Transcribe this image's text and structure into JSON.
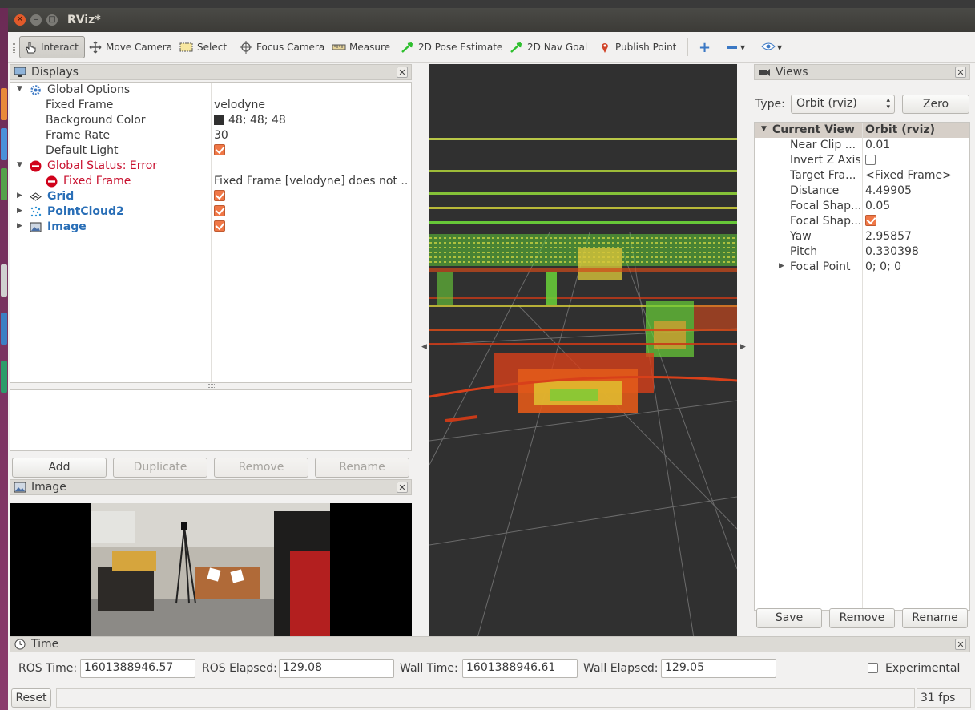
{
  "window": {
    "title": "RViz*"
  },
  "toolbar": {
    "tools": [
      "Interact",
      "Move Camera",
      "Select",
      "Focus Camera",
      "Measure",
      "2D Pose Estimate",
      "2D Nav Goal",
      "Publish Point"
    ]
  },
  "displays": {
    "title": "Displays",
    "rows": {
      "global_options": "Global Options",
      "fixed_frame_label": "Fixed Frame",
      "fixed_frame_value": "velodyne",
      "bg_color_label": "Background Color",
      "bg_color_value": "48; 48; 48",
      "frame_rate_label": "Frame Rate",
      "frame_rate_value": "30",
      "default_light_label": "Default Light",
      "global_status": "Global Status: Error",
      "status_fixed_frame": "Fixed Frame",
      "status_fixed_frame_value": "Fixed Frame [velodyne] does not ...",
      "grid": "Grid",
      "pointcloud2": "PointCloud2",
      "image": "Image"
    },
    "buttons": {
      "add": "Add",
      "duplicate": "Duplicate",
      "remove": "Remove",
      "rename": "Rename"
    }
  },
  "image_panel": {
    "title": "Image"
  },
  "views": {
    "title": "Views",
    "type_label": "Type:",
    "type_value": "Orbit (rviz)",
    "zero": "Zero",
    "header_key": "Current View",
    "header_value": "Orbit (rviz)",
    "rows": [
      {
        "k": "Near Clip ...",
        "v": "0.01"
      },
      {
        "k": "Invert Z Axis",
        "v": ""
      },
      {
        "k": "Target Fra...",
        "v": "<Fixed Frame>"
      },
      {
        "k": "Distance",
        "v": "4.49905"
      },
      {
        "k": "Focal Shap...",
        "v": "0.05"
      },
      {
        "k": "Focal Shap...",
        "v": ""
      },
      {
        "k": "Yaw",
        "v": "2.95857"
      },
      {
        "k": "Pitch",
        "v": "0.330398"
      },
      {
        "k": "Focal Point",
        "v": "0; 0; 0"
      }
    ],
    "buttons": {
      "save": "Save",
      "remove": "Remove",
      "rename": "Rename"
    }
  },
  "time": {
    "title": "Time",
    "ros_time_label": "ROS Time:",
    "ros_time": "1601388946.57",
    "ros_elapsed_label": "ROS Elapsed:",
    "ros_elapsed": "129.08",
    "wall_time_label": "Wall Time:",
    "wall_time": "1601388946.61",
    "wall_elapsed_label": "Wall Elapsed:",
    "wall_elapsed": "129.05",
    "experimental": "Experimental"
  },
  "status": {
    "reset": "Reset",
    "fps": "31 fps"
  },
  "colors": {
    "bg_color_swatch": "#303030",
    "error": "#c8102e",
    "checkbox": "#f07746",
    "link_blue": "#2a6fb7"
  }
}
